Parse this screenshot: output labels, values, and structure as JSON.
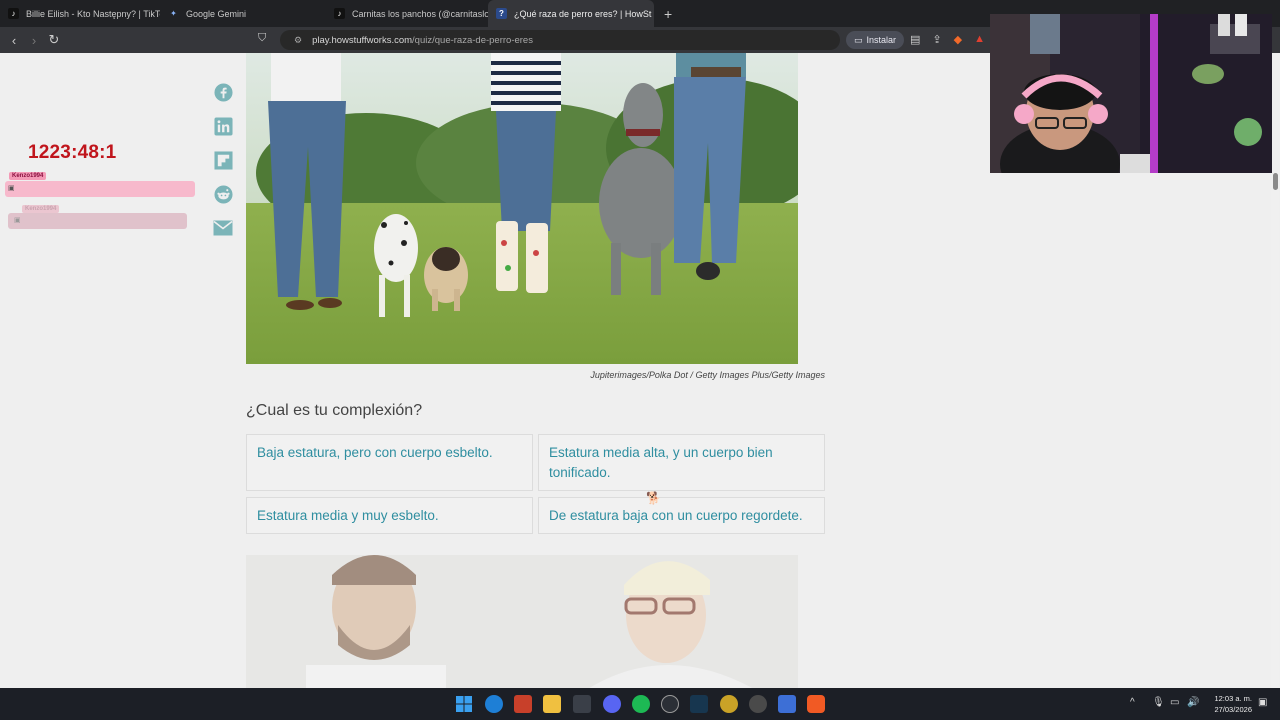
{
  "browser": {
    "tabs": [
      {
        "label": "Billie Eilish - Kto Następny? | TikTok",
        "icon": "tiktok-icon"
      },
      {
        "label": "Google Gemini",
        "icon": "gemini-icon"
      },
      {
        "label": "Carnitas los panchos (@carnitaslospa",
        "icon": "tiktok-icon"
      },
      {
        "label": "¿Qué raza de perro eres? | HowSt",
        "icon": "howstuffworks-icon",
        "active": true
      }
    ],
    "new_tab_label": "+",
    "url_host": "play.howstuffworks.com",
    "url_path": "/quiz/que-raza-de-perro-eres",
    "install_label": "Instalar"
  },
  "page": {
    "share_icons": [
      "facebook-icon",
      "linkedin-icon",
      "flipboard-icon",
      "reddit-icon",
      "email-icon"
    ],
    "image_credit": "Jupiterimages/Polka Dot / Getty Images Plus/Getty Images",
    "question": "¿Cual es tu complexión?",
    "answers": [
      "Baja estatura, pero con cuerpo esbelto.",
      "Estatura media alta, y un cuerpo bien tonificado.",
      "Estatura media y muy esbelto.",
      "De estatura baja con un cuerpo regordete."
    ]
  },
  "overlay": {
    "timer": "1223:48:1",
    "chat_user_1": "Kenzo1994",
    "chat_user_2": "Kenzo1994"
  },
  "taskbar": {
    "clock_time": "12:03 a. m.",
    "clock_date": "27/03/2026"
  }
}
